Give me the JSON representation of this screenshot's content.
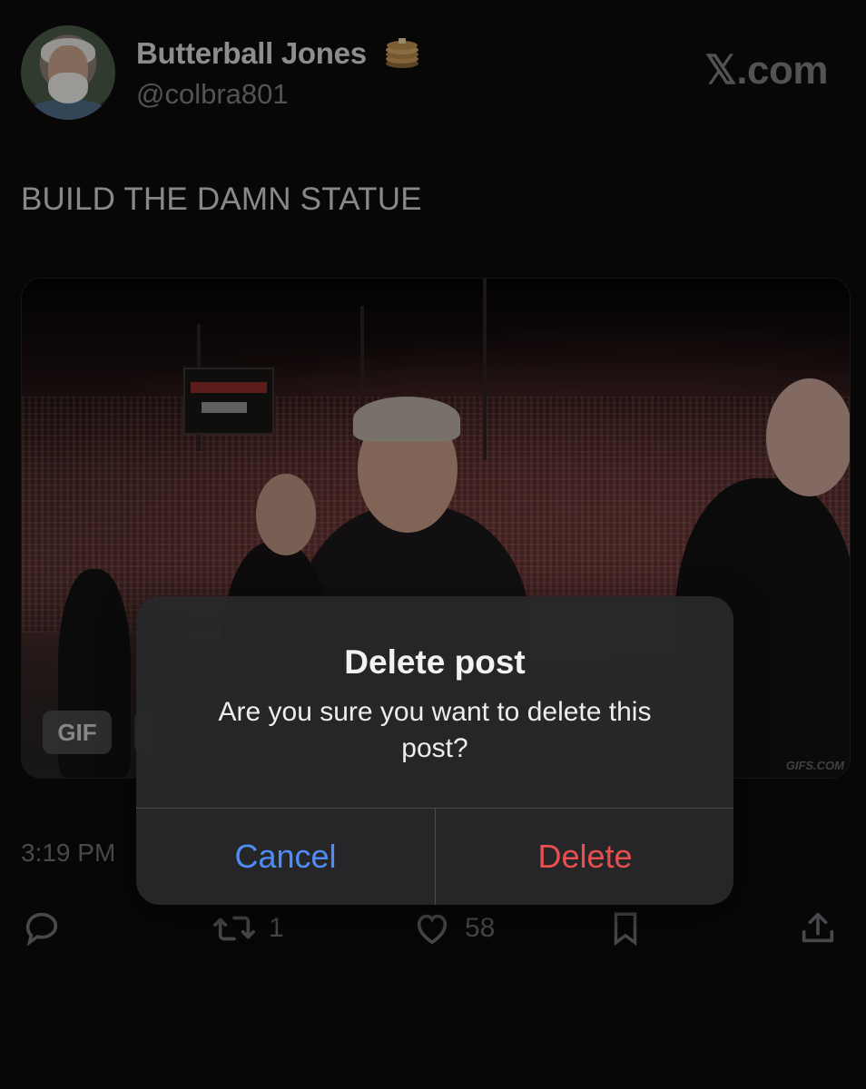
{
  "author": {
    "display_name": "Butterball Jones",
    "handle": "@colbra801",
    "badge_icon": "pancakes-emoji"
  },
  "brand": "𝕏.com",
  "post": {
    "text": "BUILD THE DAMN STATUE",
    "media_badge": "GIF",
    "watermark": "GIFS.COM",
    "timestamp": "3:19 PM"
  },
  "actions": {
    "reply_icon": "reply-icon",
    "repost_icon": "repost-icon",
    "repost_count": "1",
    "like_icon": "heart-icon",
    "like_count": "58",
    "bookmark_icon": "bookmark-icon",
    "share_icon": "share-icon"
  },
  "dialog": {
    "title": "Delete post",
    "message": "Are you sure you want to delete this post?",
    "cancel_label": "Cancel",
    "delete_label": "Delete",
    "cancel_color": "#4f8df6",
    "delete_color": "#e84f4f"
  }
}
